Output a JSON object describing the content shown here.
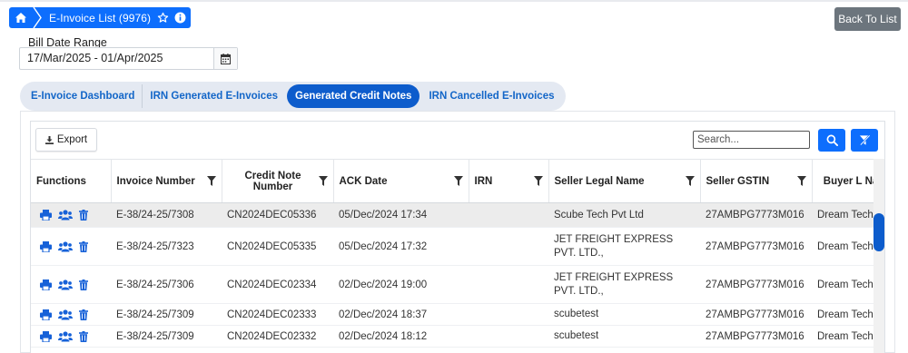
{
  "breadcrumb": {
    "title": "E-Invoice List (9976)"
  },
  "header": {
    "back_label": "Back To List"
  },
  "filters": {
    "date_label": "Bill Date Range",
    "date_value": "17/Mar/2025 - 01/Apr/2025"
  },
  "tabs": [
    {
      "label": "E-Invoice Dashboard",
      "active": false
    },
    {
      "label": "IRN Generated E-Invoices",
      "active": false
    },
    {
      "label": "Generated Credit Notes",
      "active": true
    },
    {
      "label": "IRN Cancelled E-Invoices",
      "active": false
    }
  ],
  "toolbar": {
    "export_label": "Export",
    "search_placeholder": "Search..."
  },
  "table": {
    "columns": [
      {
        "label": "Functions"
      },
      {
        "label": "Invoice Number"
      },
      {
        "label": "Credit Note Number"
      },
      {
        "label": "ACK Date"
      },
      {
        "label": "IRN"
      },
      {
        "label": "Seller Legal Name"
      },
      {
        "label": "Seller GSTIN"
      },
      {
        "label": "Buyer L Nam"
      }
    ],
    "rows": [
      {
        "invoice": "E-38/24-25/7308",
        "credit_note": "CN2024DEC05336",
        "ack_date": "05/Dec/2024 17:34",
        "irn": "",
        "seller_name": "Scube Tech Pvt Ltd",
        "seller_gstin": "27AMBPG7773M016",
        "buyer": "Dream Tech"
      },
      {
        "invoice": "E-38/24-25/7323",
        "credit_note": "CN2024DEC05335",
        "ack_date": "05/Dec/2024 17:32",
        "irn": "",
        "seller_name": "JET FREIGHT EXPRESS PVT. LTD.,",
        "seller_gstin": "27AMBPG7773M016",
        "buyer": "Dream Tech"
      },
      {
        "invoice": "E-38/24-25/7306",
        "credit_note": "CN2024DEC02334",
        "ack_date": "02/Dec/2024 19:00",
        "irn": "",
        "seller_name": "JET FREIGHT EXPRESS PVT. LTD.,",
        "seller_gstin": "27AMBPG7773M016",
        "buyer": "Dream Tech"
      },
      {
        "invoice": "E-38/24-25/7309",
        "credit_note": "CN2024DEC02333",
        "ack_date": "02/Dec/2024 18:37",
        "irn": "",
        "seller_name": "scubetest",
        "seller_gstin": "27AMBPG7773M016",
        "buyer": "Dream Tech"
      },
      {
        "invoice": "E-38/24-25/7309",
        "credit_note": "CN2024DEC02332",
        "ack_date": "02/Dec/2024 18:12",
        "irn": "",
        "seller_name": "scubetest",
        "seller_gstin": "27AMBPG7773M016",
        "buyer": "Dream Tech"
      }
    ]
  },
  "colors": {
    "primary": "#0d6efd",
    "tab_active": "#0d5ccc",
    "secondary": "#6c757d"
  }
}
